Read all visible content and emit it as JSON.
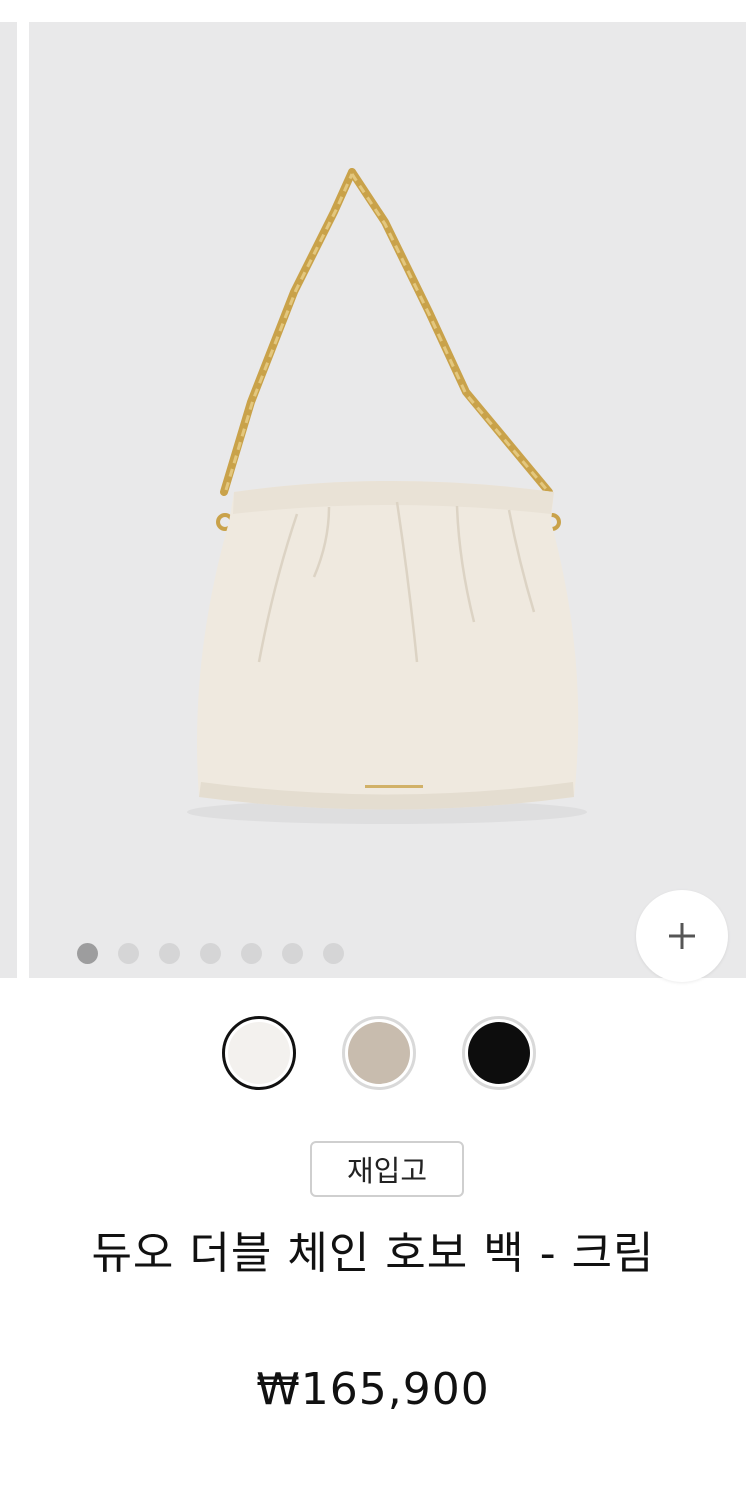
{
  "gallery": {
    "slide_count": 7,
    "active_index": 0,
    "image_alt": "듀오 더블 체인 호보 백 - 크림",
    "zoom_icon": "plus-icon"
  },
  "colors": {
    "background": "#e9e9ea",
    "dot_inactive": "#d5d5d6",
    "dot_active": "#9d9d9e",
    "bag_cream": "#efe9df",
    "chain_gold": "#c9a24a"
  },
  "swatches": [
    {
      "name": "크림",
      "color": "#f3f1ee",
      "selected": true
    },
    {
      "name": "베이지",
      "color": "#c8bcae",
      "selected": false
    },
    {
      "name": "블랙",
      "color": "#0d0d0d",
      "selected": false
    }
  ],
  "product": {
    "badge": "재입고",
    "title": "듀오 더블 체인 호보 백 - 크림",
    "price": "₩165,900"
  }
}
